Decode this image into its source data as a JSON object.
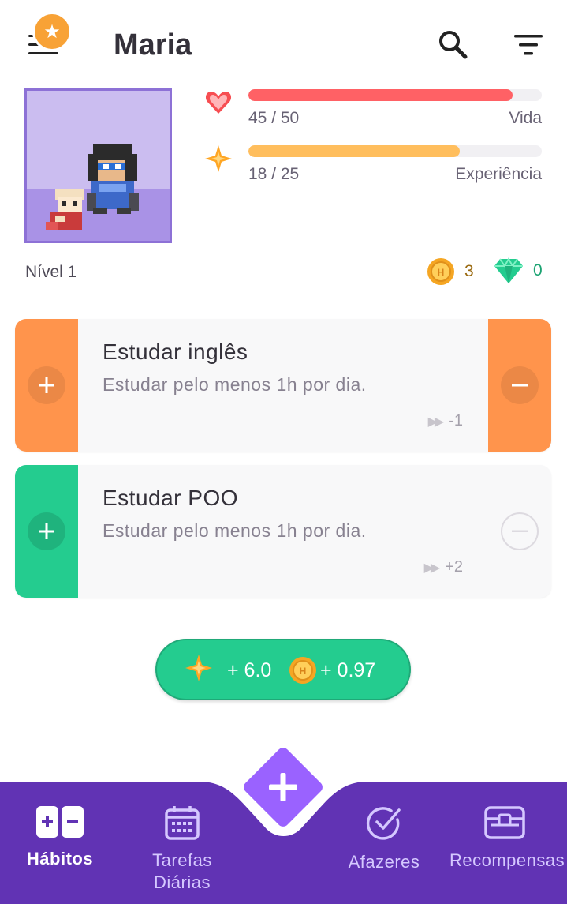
{
  "header": {
    "title": "Maria"
  },
  "stats": {
    "health": {
      "current": 45,
      "max": 50,
      "text": "45 / 50",
      "label": "Vida",
      "color": "#ff6165"
    },
    "experience": {
      "current": 18,
      "max": 25,
      "text": "18 / 25",
      "label": "Experiência",
      "color": "#ffbe5d"
    },
    "level": "Nível 1",
    "gold": "3",
    "gems": "0"
  },
  "habits": [
    {
      "title": "Estudar inglês",
      "notes": "Estudar pelo menos 1h por dia.",
      "streak": "-1",
      "color": "#ff944c",
      "plus_symbol": "+",
      "minus_symbol": "−"
    },
    {
      "title": "Estudar POO",
      "notes": "Estudar pelo menos 1h por dia.",
      "streak": "+2",
      "color": "#24cc8f",
      "plus_symbol": "+",
      "minus_symbol": "−"
    }
  ],
  "reward": {
    "exp": "+ 6.0",
    "gold": "+ 0.97"
  },
  "fab": {
    "symbol": "+"
  },
  "bottom_nav": [
    {
      "label": "Hábitos",
      "icon": "habits-icon",
      "active": true
    },
    {
      "label": "Tarefas Diárias",
      "icon": "calendar-icon",
      "active": false
    },
    {
      "label": "Afazeres",
      "icon": "check-circle-icon",
      "active": false
    },
    {
      "label": "Recompensas",
      "icon": "treasure-chest-icon",
      "active": false
    }
  ],
  "colors": {
    "nav": "#6133b4",
    "fab": "#9a62ff",
    "accent_purple": "#8d71d6"
  }
}
